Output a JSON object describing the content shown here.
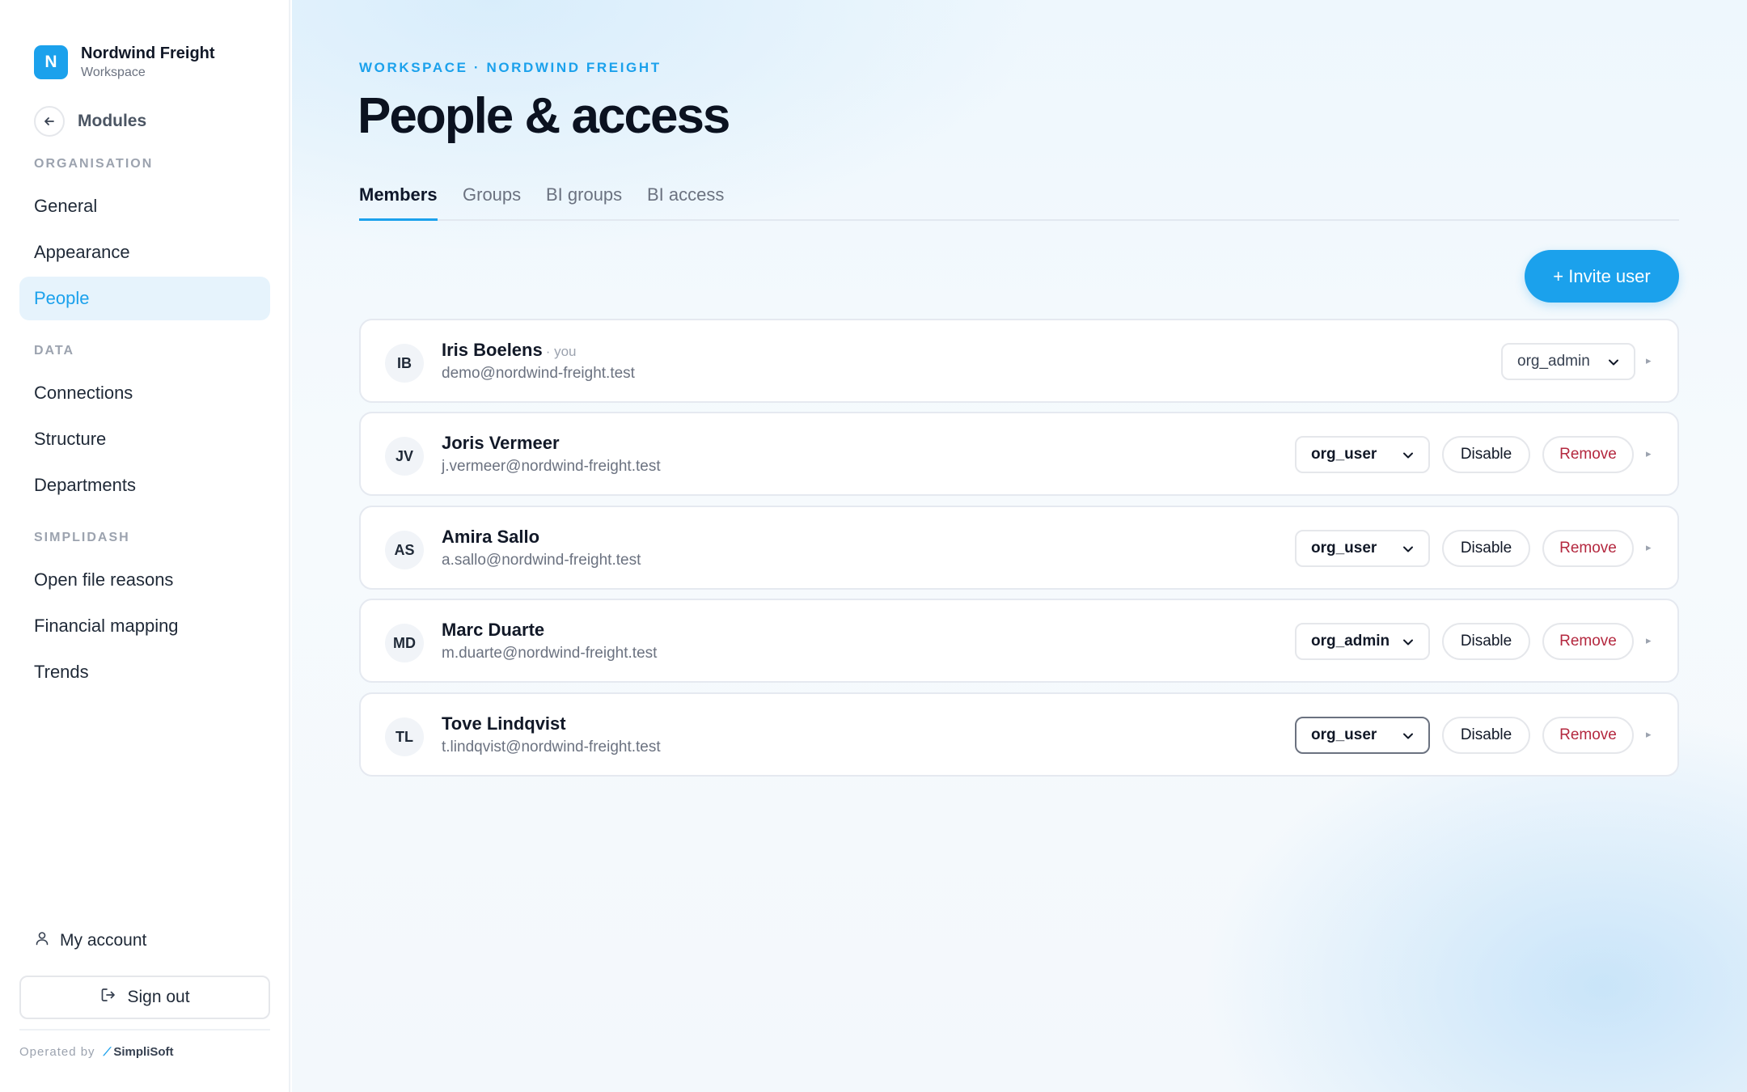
{
  "brand": {
    "initial": "N",
    "name": "Nordwind Freight",
    "subtitle": "Workspace"
  },
  "back": {
    "label": "Modules"
  },
  "sidebar": {
    "sections": [
      {
        "title": "ORGANISATION",
        "items": [
          "General",
          "Appearance",
          "People"
        ]
      },
      {
        "title": "DATA",
        "items": [
          "Connections",
          "Structure",
          "Departments"
        ]
      },
      {
        "title": "SIMPLIDASH",
        "items": [
          "Open file reasons",
          "Financial mapping",
          "Trends"
        ]
      }
    ],
    "active_item": "People",
    "my_account": "My account",
    "sign_out": "Sign out",
    "operated_by": "Operated by",
    "operator_logo": "SimpliSoft"
  },
  "main": {
    "eyebrow": "WORKSPACE · NORDWIND FREIGHT",
    "title": "People & access",
    "tabs": [
      "Members",
      "Groups",
      "BI groups",
      "BI access"
    ],
    "active_tab": "Members",
    "invite_label": "+ Invite user",
    "disable_label": "Disable",
    "remove_label": "Remove",
    "caret": "▸"
  },
  "members": [
    {
      "initials": "IB",
      "name": "Iris Boelens",
      "you": "· you",
      "email": "demo@nordwind-freight.test",
      "role": "org_admin"
    },
    {
      "initials": "JV",
      "name": "Joris Vermeer",
      "email": "j.vermeer@nordwind-freight.test",
      "role": "org_user"
    },
    {
      "initials": "AS",
      "name": "Amira Sallo",
      "email": "a.sallo@nordwind-freight.test",
      "role": "org_user"
    },
    {
      "initials": "MD",
      "name": "Marc Duarte",
      "email": "m.duarte@nordwind-freight.test",
      "role": "org_admin"
    },
    {
      "initials": "TL",
      "name": "Tove Lindqvist",
      "email": "t.lindqvist@nordwind-freight.test",
      "role": "org_user"
    }
  ],
  "colors": {
    "accent": "#1ba1ec",
    "danger": "#b4283f",
    "active_nav_bg": "#e6f3fc"
  },
  "icons": {
    "back": "arrow-left-icon",
    "account": "user-icon",
    "sign_out": "sign-out-icon",
    "select": "chevron-down-icon",
    "row_expand": "caret-right-icon"
  }
}
